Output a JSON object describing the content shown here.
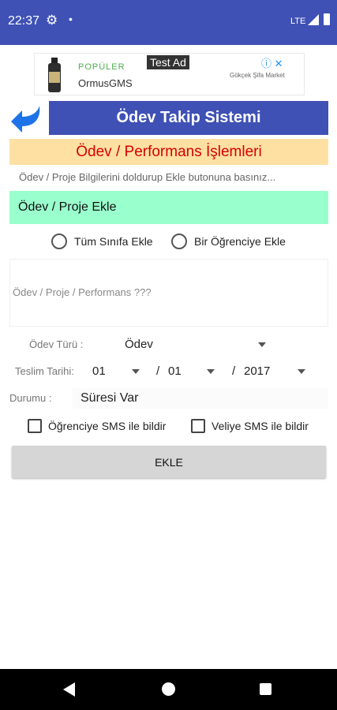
{
  "status_bar": {
    "time": "22:37",
    "network": "LTE",
    "icons": [
      "gear-icon",
      "dot-icon",
      "signal-icon",
      "battery-icon"
    ]
  },
  "ad": {
    "popular": "POPÜLER",
    "brand": "OrmusGMS",
    "test_label": "Test Ad",
    "info": "ⓘ ✕",
    "market": "Gökçek Şifa Market"
  },
  "header": {
    "title": "Ödev Takip Sistemi",
    "back_icon": "back-arrow-icon"
  },
  "section": {
    "title": "Ödev / Performans İşlemleri",
    "hint": "Ödev / Proje Bilgilerini doldurup Ekle butonuna basınız..."
  },
  "homework_field": "Ödev / Proje Ekle",
  "radio_options": {
    "all_class": "Tüm Sınıfa Ekle",
    "one_student": "Bir Öğrenciye Ekle"
  },
  "description_placeholder": "Ödev / Proje / Performans ???",
  "form": {
    "type_label": "Ödev Türü :",
    "type_value": "Ödev",
    "date_label": "Teslim Tarihi:",
    "day": "01",
    "month": "01",
    "year": "2017",
    "separator": "/",
    "status_label": "Durumu :",
    "status_value": "Süresi Var"
  },
  "checkboxes": {
    "student_sms": "Öğrenciye SMS ile bildir",
    "parent_sms": "Veliye SMS ile bildir"
  },
  "submit_label": "EKLE",
  "colors": {
    "primary": "#3f51b5",
    "section_bg": "#ffe0a3",
    "section_text": "#d50000",
    "homework_bg": "#99ffcc",
    "button_bg": "#d6d6d6"
  }
}
